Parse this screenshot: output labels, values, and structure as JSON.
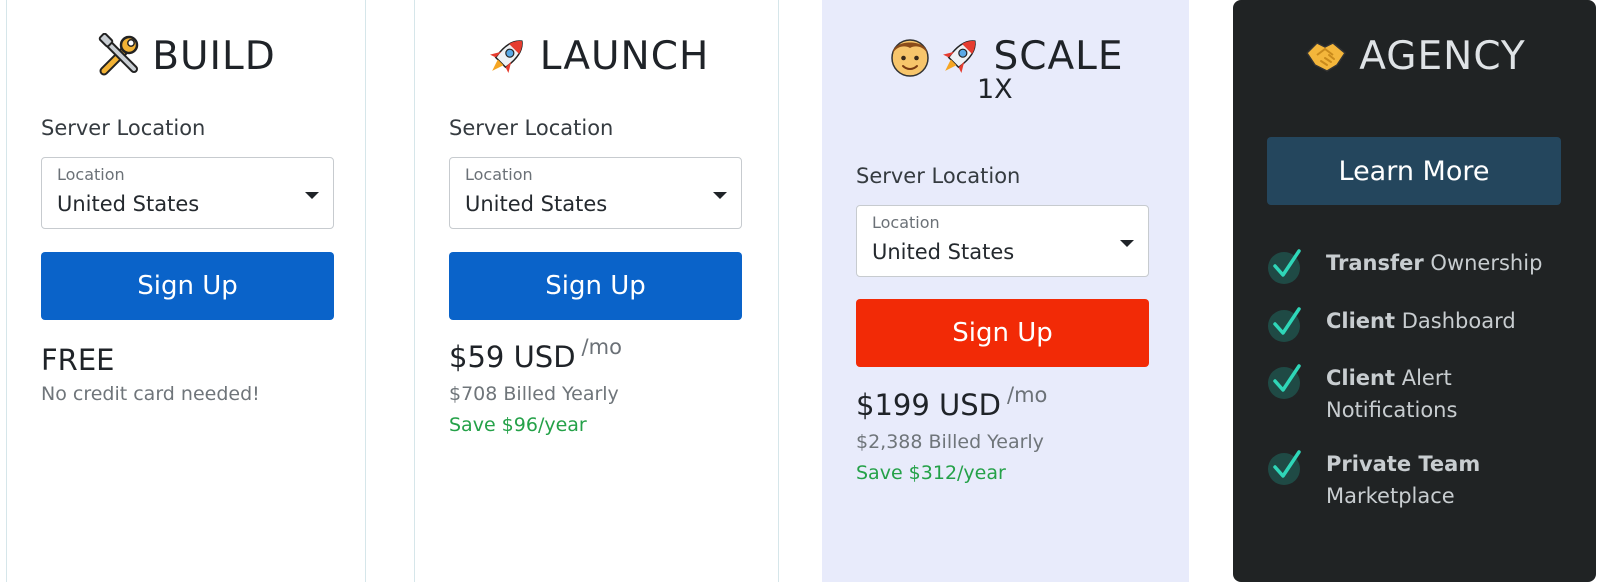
{
  "plans": {
    "build": {
      "name": "BUILD",
      "icon": "tools-icon",
      "server_label": "Server Location",
      "location_caption": "Location",
      "location_value": "United States",
      "signup_label": "Sign Up",
      "button_color": "#0a63c9",
      "price": "FREE",
      "note": "No credit card needed!"
    },
    "launch": {
      "name": "LAUNCH",
      "icon": "rocket-icon",
      "server_label": "Server Location",
      "location_caption": "Location",
      "location_value": "United States",
      "signup_label": "Sign Up",
      "button_color": "#0a63c9",
      "price": "$59 USD",
      "price_suffix": "/mo",
      "billed": "$708 Billed Yearly",
      "save": "Save $96/year"
    },
    "scale": {
      "name": "SCALE",
      "icons": [
        "person-icon",
        "rocket-icon"
      ],
      "tier": "1X",
      "background": "#e8ebfb",
      "server_label": "Server Location",
      "location_caption": "Location",
      "location_value": "United States",
      "signup_label": "Sign Up",
      "button_color": "#f22a06",
      "price": "$199 USD",
      "price_suffix": "/mo",
      "billed": "$2,388 Billed Yearly",
      "save": "Save $312/year"
    },
    "agency": {
      "name": "AGENCY",
      "icon": "handshake-icon",
      "background": "#202324",
      "learn_more_label": "Learn More",
      "features": [
        {
          "bold": "Transfer",
          "text": "Ownership"
        },
        {
          "bold": "Client",
          "text": "Dashboard"
        },
        {
          "bold": "Client",
          "text": "Alert",
          "text2": "Notifications"
        },
        {
          "bold": "Private Team",
          "text2": "Marketplace"
        }
      ]
    }
  },
  "colors": {
    "save_green": "#24a148",
    "check_teal": "#2fd6b8",
    "learn_more_bg": "#24465d"
  }
}
